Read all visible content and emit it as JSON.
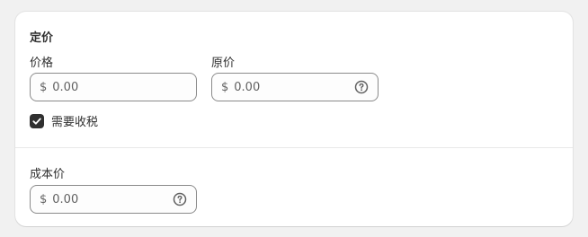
{
  "pricing": {
    "title": "定价",
    "price": {
      "label": "价格",
      "currency": "$",
      "placeholder": "0.00"
    },
    "compare_at_price": {
      "label": "原价",
      "currency": "$",
      "placeholder": "0.00",
      "help_icon": "question-circle-icon"
    },
    "charge_tax": {
      "label": "需要收税",
      "checked": true
    },
    "cost_per_item": {
      "label": "成本价",
      "currency": "$",
      "placeholder": "0.00",
      "help_icon": "question-circle-icon"
    }
  },
  "colors": {
    "page_bg": "#f1f1f1",
    "card_bg": "#ffffff",
    "checkbox_fill": "#303030",
    "input_border": "#8a8a8a"
  }
}
